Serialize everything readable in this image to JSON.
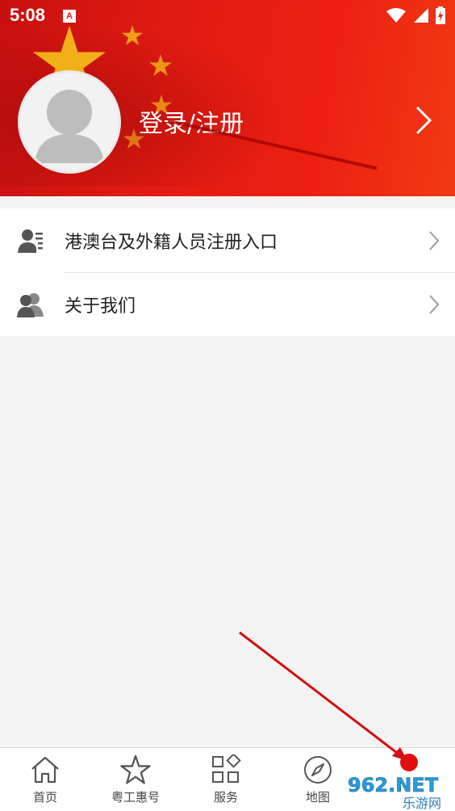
{
  "status_bar": {
    "time": "5:08",
    "notification_icon": "a-letter-icon",
    "icons": [
      "wifi-icon",
      "signal-icon",
      "battery-charging-icon"
    ]
  },
  "profile": {
    "avatar_icon": "default-avatar-icon",
    "login_label": "登录/注册"
  },
  "menu": {
    "items": [
      {
        "label": "港澳台及外籍人员注册入口",
        "icon": "person-card-icon"
      },
      {
        "label": "关于我们",
        "icon": "people-icon"
      }
    ]
  },
  "bottom_nav": {
    "items": [
      {
        "label": "首页",
        "icon": "home-icon"
      },
      {
        "label": "粤工惠号",
        "icon": "star-icon"
      },
      {
        "label": "服务",
        "icon": "grid-diamond-icon"
      },
      {
        "label": "地图",
        "icon": "compass-icon"
      }
    ]
  },
  "watermark": {
    "text_top": "962.NET",
    "text_bottom": "乐游网"
  },
  "colors": {
    "header_red": "#e01a12",
    "annotation_red": "#d11010",
    "background": "#f3f3f3"
  }
}
